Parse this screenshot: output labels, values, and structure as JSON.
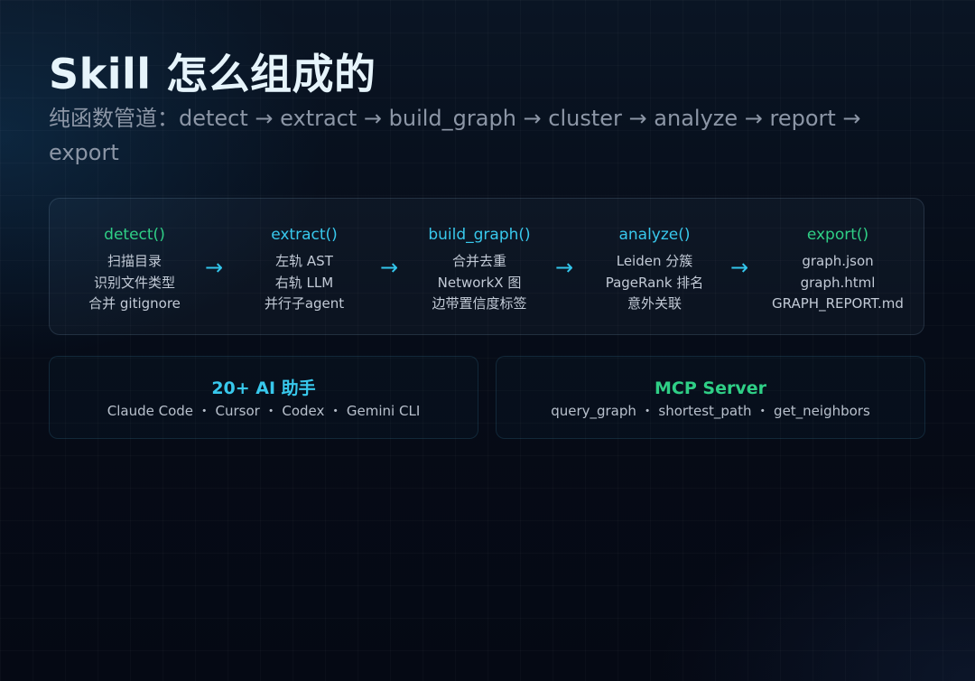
{
  "header": {
    "title": "Skill 怎么组成的",
    "subtitle": "纯函数管道：detect → extract → build_graph → cluster → analyze → report → export"
  },
  "pipeline": {
    "stages": [
      {
        "title": "detect()",
        "lines": [
          "扫描目录",
          "识别文件类型",
          "合并 gitignore"
        ]
      },
      {
        "title": "extract()",
        "lines": [
          "左轨 AST",
          "右轨 LLM",
          "并行子agent"
        ]
      },
      {
        "title": "build_graph()",
        "lines": [
          "合并去重",
          "NetworkX 图",
          "边带置信度标签"
        ]
      },
      {
        "title": "analyze()",
        "lines": [
          "Leiden 分簇",
          "PageRank 排名",
          "意外关联"
        ]
      },
      {
        "title": "export()",
        "lines": [
          "graph.json",
          "graph.html",
          "GRAPH_REPORT.md"
        ]
      }
    ],
    "arrow": "→"
  },
  "cards": [
    {
      "title": "20+ AI 助手",
      "line": "Claude Code ・ Cursor ・ Codex ・ Gemini CLI"
    },
    {
      "title": "MCP Server",
      "line": "query_graph ・ shortest_path ・ get_neighbors"
    }
  ],
  "colors": {
    "background": "#060b16",
    "title": "#e6f4fb",
    "subtitle": "#8c96a6",
    "accent_green": "#2fcf86",
    "accent_cyan": "#38c8ec",
    "body_text": "#c2cad6"
  }
}
